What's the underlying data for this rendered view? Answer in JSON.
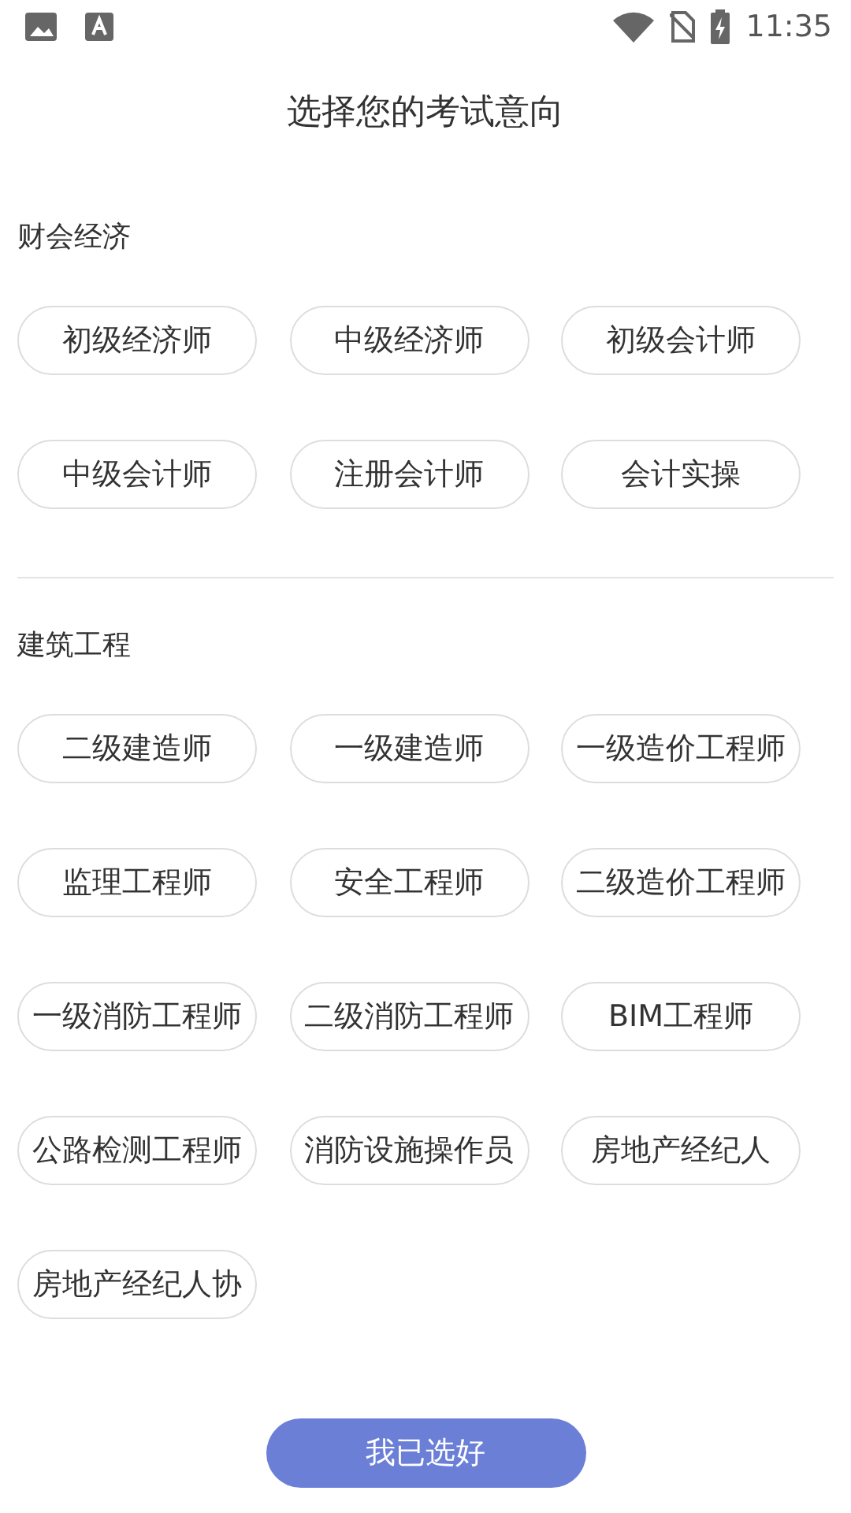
{
  "status_bar": {
    "time": "11:35"
  },
  "title": "选择您的考试意向",
  "sections": [
    {
      "title": "财会经济",
      "options": [
        {
          "label": "初级经济师",
          "selected": false
        },
        {
          "label": "中级经济师",
          "selected": false
        },
        {
          "label": "初级会计师",
          "selected": false
        },
        {
          "label": "中级会计师",
          "selected": false
        },
        {
          "label": "注册会计师",
          "selected": false
        },
        {
          "label": "会计实操",
          "selected": false
        }
      ]
    },
    {
      "title": "建筑工程",
      "options": [
        {
          "label": "二级建造师",
          "selected": false
        },
        {
          "label": "一级建造师",
          "selected": false
        },
        {
          "label": "一级造价工程师",
          "selected": false
        },
        {
          "label": "监理工程师",
          "selected": false
        },
        {
          "label": "安全工程师",
          "selected": false
        },
        {
          "label": "二级造价工程师",
          "selected": false
        },
        {
          "label": "一级消防工程师",
          "selected": false
        },
        {
          "label": "二级消防工程师",
          "selected": false
        },
        {
          "label": "BIM工程师",
          "selected": false
        },
        {
          "label": "公路检测工程师",
          "selected": false
        },
        {
          "label": "消防设施操作员",
          "selected": false
        },
        {
          "label": "房地产经纪人",
          "selected": false
        },
        {
          "label": "房地产经纪人协",
          "selected": false
        }
      ]
    }
  ],
  "confirm_button": "我已选好"
}
